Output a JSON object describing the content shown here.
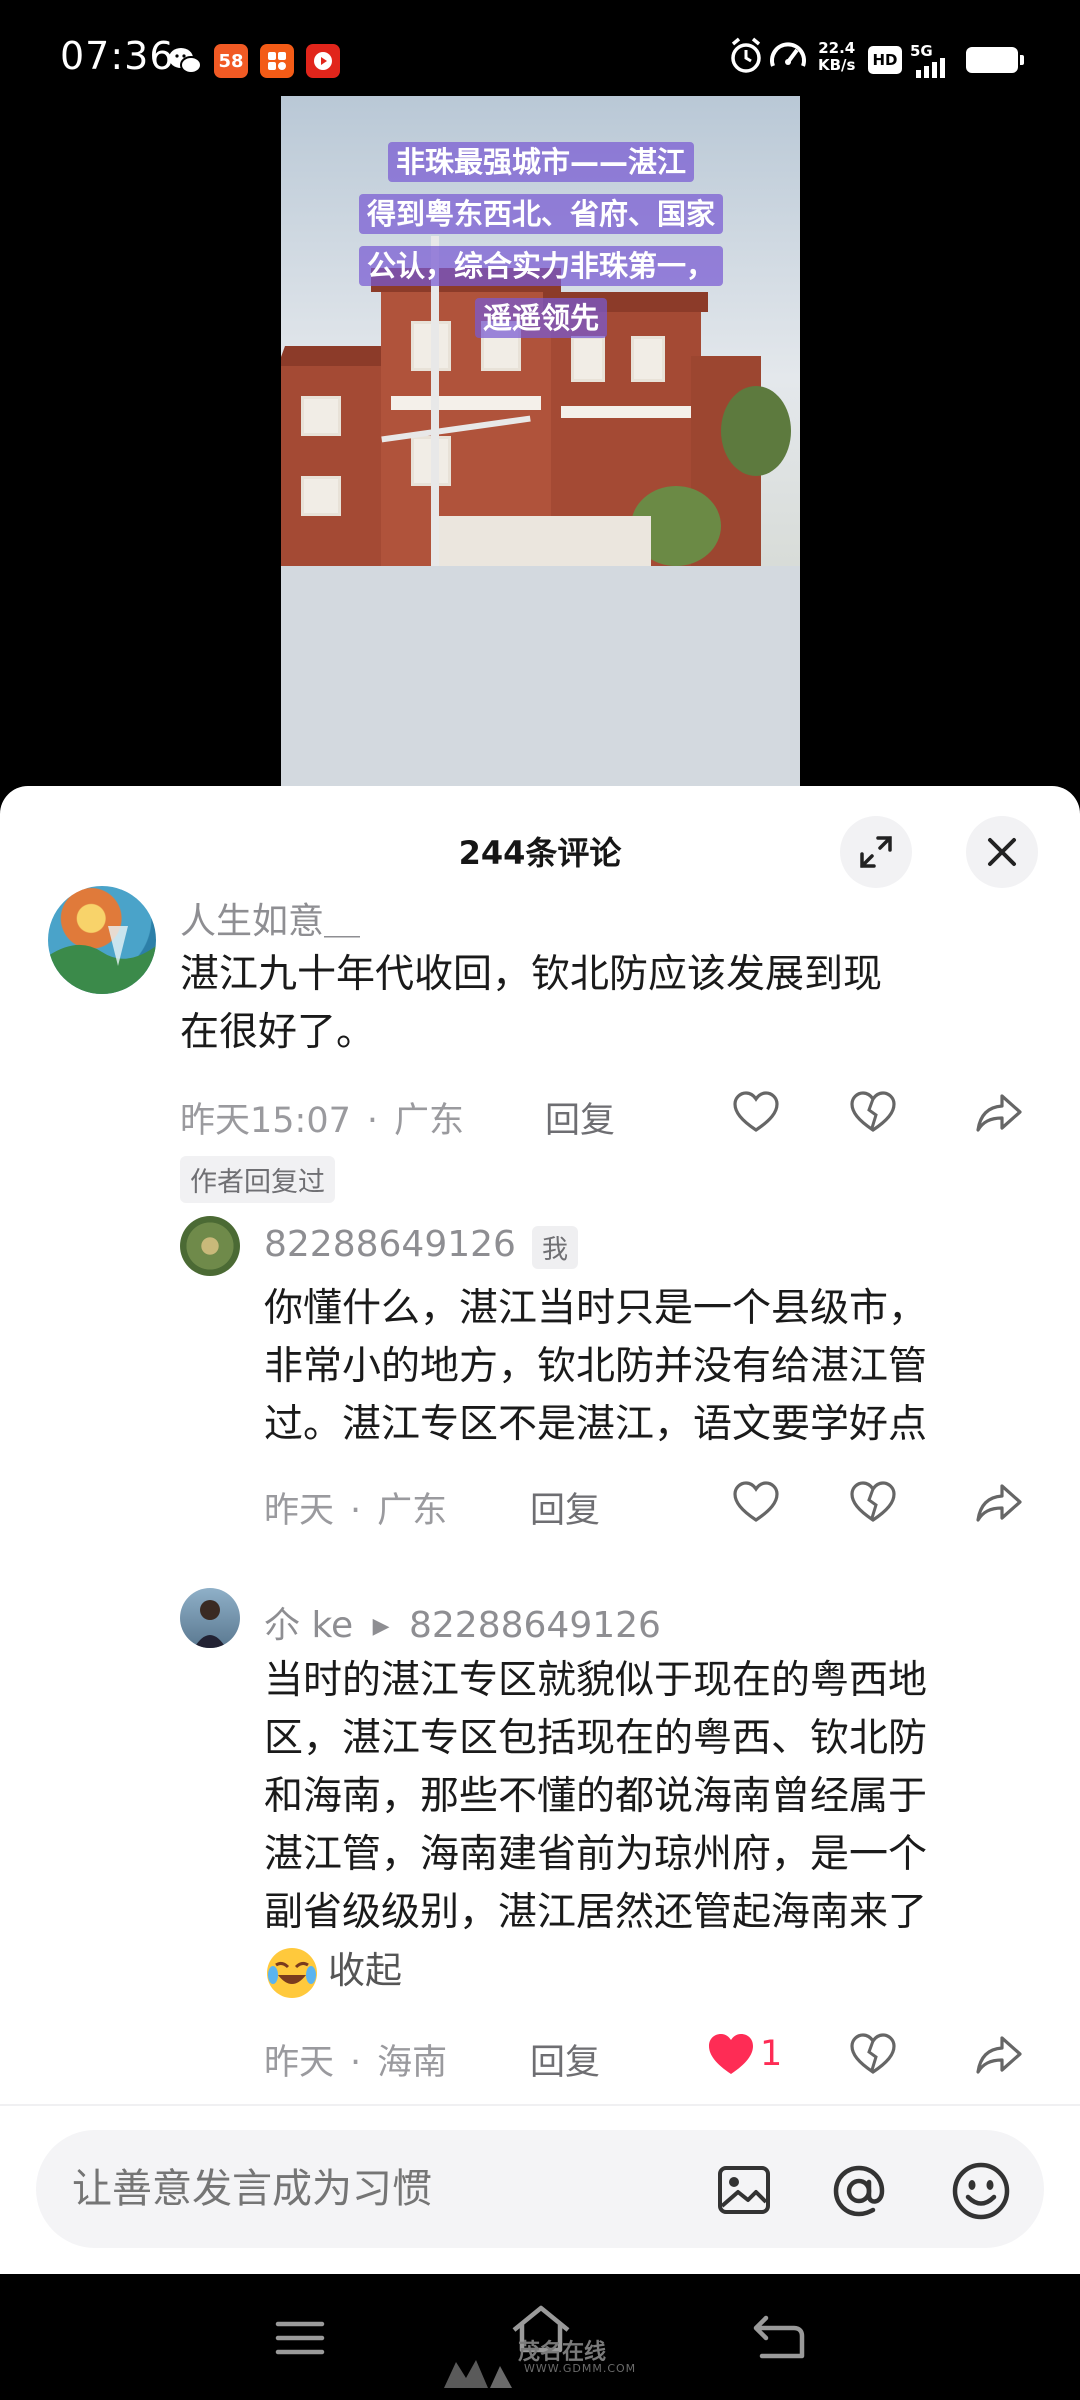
{
  "status_bar": {
    "time": "07:36",
    "apps": [
      {
        "icon": "wechat-icon",
        "label": ""
      },
      {
        "icon": "58-app-icon",
        "label": "58",
        "color": "#f15a24"
      },
      {
        "icon": "puzzle-app-icon",
        "label": "",
        "color": "#f35b16"
      },
      {
        "icon": "video-app-icon",
        "label": "",
        "color": "#e1251b"
      }
    ],
    "net_speed": "22.4",
    "net_unit": "KB/s",
    "hd": "HD",
    "signal": "5G",
    "battery_percent": 100
  },
  "video": {
    "caption_lines": [
      "非珠最强城市——湛江",
      "得到粤东西北、省府、国家",
      "公认，综合实力非珠第一，",
      "遥遥领先"
    ]
  },
  "comments_panel": {
    "title": "244条评论",
    "comments": [
      {
        "username": "人生如意＿",
        "text_lines": [
          "湛江九十年代收回，钦北防应该发展到现",
          "在很好了。"
        ],
        "time": "昨天15:07",
        "location": "广东",
        "reply_label": "回复",
        "tag": "作者回复过",
        "likes": "",
        "liked": false
      },
      {
        "username": "82288649126",
        "me_label": "我",
        "text_lines": [
          "你懂什么，湛江当时只是一个县级市，",
          "非常小的地方，钦北防并没有给湛江管",
          "过。湛江专区不是湛江，语文要学好点"
        ],
        "time": "昨天",
        "location": "广东",
        "reply_label": "回复",
        "likes": "",
        "liked": false
      },
      {
        "username": "尒 ke",
        "reply_to": "82288649126",
        "text_lines": [
          "当时的湛江专区就貌似于现在的粤西地",
          "区，湛江专区包括现在的粤西、钦北防",
          "和海南，那些不懂的都说海南曾经属于",
          "湛江管，海南建省前为琼州府，是一个",
          "副省级级别，湛江居然还管起海南来了"
        ],
        "collapse_label": "收起",
        "time": "昨天",
        "location": "海南",
        "reply_label": "回复",
        "likes": "1",
        "liked": true
      }
    ],
    "separator": "·"
  },
  "input": {
    "placeholder": "让善意发言成为习惯"
  },
  "watermark": {
    "name": "茂名在线",
    "url": "WWW.GDMM.COM"
  },
  "colors": {
    "accent_like": "#fe2c55",
    "caption_bg": "#785ad2"
  }
}
